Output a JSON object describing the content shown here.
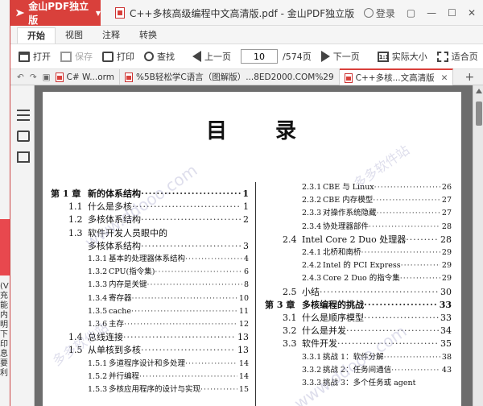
{
  "background_window": {
    "text_fragments": "(V\n充\n能\n内\n明\n下\n印\n息\n要\n利"
  },
  "app": {
    "name": "金山PDF独立版",
    "document_title": "C++多核高级编程中文高清版.pdf - 金山PDF独立版",
    "login_label": "登录",
    "accent_color": "#d9403b"
  },
  "menu_tabs": [
    {
      "label": "开始",
      "active": true
    },
    {
      "label": "视图",
      "active": false
    },
    {
      "label": "注释",
      "active": false
    },
    {
      "label": "转换",
      "active": false
    }
  ],
  "toolbar": {
    "open_label": "打开",
    "save_label": "保存",
    "print_label": "打印",
    "find_label": "查找",
    "prev_label": "上一页",
    "page_value": "10",
    "page_total": "/574页",
    "next_label": "下一页",
    "actual_size_label": "实际大小",
    "actual_size_icon_text": "1:1",
    "fit_label": "适合页"
  },
  "doc_tabs": [
    {
      "label": "C# W...orm",
      "active": false
    },
    {
      "label": "%5B轻松学C语言（图解版）...8ED2000.COM%29",
      "active": false
    },
    {
      "label": "C++多核...文高清版",
      "active": true
    }
  ],
  "page": {
    "heading": "目录",
    "watermark": "www.ddooo.com",
    "watermark2": "多多软件站"
  },
  "toc_left": [
    {
      "num": "第 1 章",
      "title": "新的体系结构",
      "page": "1",
      "type": "chapter"
    },
    {
      "num": "1.1",
      "title": "什么是多核",
      "page": "1",
      "type": "section"
    },
    {
      "num": "1.2",
      "title": "多核体系结构",
      "page": "2",
      "type": "section"
    },
    {
      "num": "1.3",
      "title": "软件开发人员眼中的",
      "page": "",
      "type": "section-nodots"
    },
    {
      "num": "",
      "title": "多核体系结构",
      "page": "3",
      "type": "section"
    },
    {
      "num": "1.3.1",
      "title": "基本的处理器体系结构",
      "page": "4",
      "type": "sub"
    },
    {
      "num": "1.3.2",
      "title": "CPU(指令集)",
      "page": "6",
      "type": "sub"
    },
    {
      "num": "1.3.3",
      "title": "内存是关键",
      "page": "8",
      "type": "sub"
    },
    {
      "num": "1.3.4",
      "title": "寄存器",
      "page": "10",
      "type": "sub"
    },
    {
      "num": "1.3.5",
      "title": "cache",
      "page": "11",
      "type": "sub"
    },
    {
      "num": "1.3.6",
      "title": "主存",
      "page": "12",
      "type": "sub"
    },
    {
      "num": "1.4",
      "title": "总线连接",
      "page": "13",
      "type": "section"
    },
    {
      "num": "1.5",
      "title": "从单核到多核",
      "page": "13",
      "type": "section"
    },
    {
      "num": "1.5.1",
      "title": "多道程序设计和多处理",
      "page": "14",
      "type": "sub"
    },
    {
      "num": "1.5.2",
      "title": "并行编程",
      "page": "14",
      "type": "sub"
    },
    {
      "num": "1.5.3",
      "title": "多核应用程序的设计与实现",
      "page": "15",
      "type": "sub"
    }
  ],
  "toc_right": [
    {
      "num": "2.3.1",
      "title": "CBE 与 Linux",
      "page": "26",
      "type": "sub"
    },
    {
      "num": "2.3.2",
      "title": "CBE 内存模型",
      "page": "27",
      "type": "sub"
    },
    {
      "num": "2.3.3",
      "title": "对操作系统隐藏",
      "page": "27",
      "type": "sub"
    },
    {
      "num": "2.3.4",
      "title": "协处理器部件",
      "page": "28",
      "type": "sub"
    },
    {
      "num": "2.4",
      "title": "Intel Core 2 Duo 处理器",
      "page": "28",
      "type": "section"
    },
    {
      "num": "2.4.1",
      "title": "北桥和南桥",
      "page": "29",
      "type": "sub"
    },
    {
      "num": "2.4.2",
      "title": "Intel 的 PCI Express",
      "page": "29",
      "type": "sub"
    },
    {
      "num": "2.4.3",
      "title": "Core 2 Duo 的指令集",
      "page": "29",
      "type": "sub"
    },
    {
      "num": "2.5",
      "title": "小结",
      "page": "30",
      "type": "section"
    },
    {
      "num": "第 3 章",
      "title": "多核编程的挑战",
      "page": "33",
      "type": "chapter"
    },
    {
      "num": "3.1",
      "title": "什么是顺序模型",
      "page": "33",
      "type": "section"
    },
    {
      "num": "3.2",
      "title": "什么是并发",
      "page": "34",
      "type": "section"
    },
    {
      "num": "3.3",
      "title": "软件开发",
      "page": "35",
      "type": "section"
    },
    {
      "num": "3.3.1",
      "title": "挑战 1：软件分解",
      "page": "38",
      "type": "sub"
    },
    {
      "num": "3.3.2",
      "title": "挑战 2：任务间通信",
      "page": "43",
      "type": "sub"
    },
    {
      "num": "3.3.3",
      "title": "挑战 3：多个任务或 agent",
      "page": "",
      "type": "sub-nodots"
    }
  ]
}
